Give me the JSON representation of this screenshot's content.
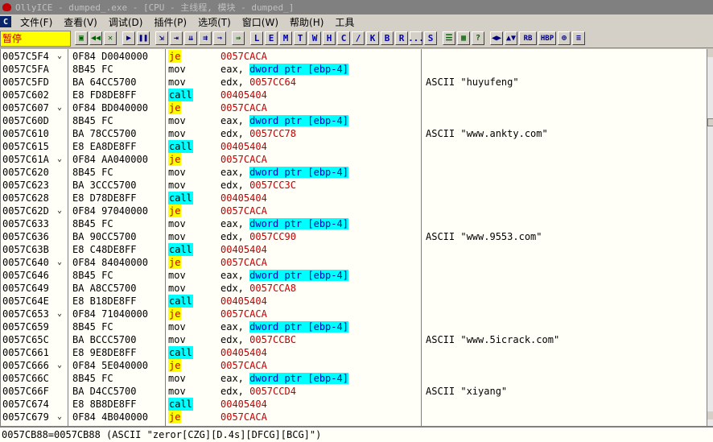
{
  "window": {
    "title": "OllyICE - dumped_.exe - [CPU - 主线程, 模块 - dumped_]"
  },
  "menu": {
    "cpu_icon": "C",
    "items": [
      "文件(F)",
      "查看(V)",
      "调试(D)",
      "插件(P)",
      "选项(T)",
      "窗口(W)",
      "帮助(H)",
      "工具"
    ]
  },
  "toolbar": {
    "status": "暂停",
    "letters": [
      "L",
      "E",
      "M",
      "T",
      "W",
      "H",
      "C",
      "/",
      "K",
      "B",
      "R",
      "...",
      "S"
    ]
  },
  "rows": [
    {
      "addr": "0057C5F4",
      "mark": "⌄",
      "hex": "0F84 D0040000",
      "mnem": "je",
      "type": "je",
      "ops": "0057CACA",
      "comment": ""
    },
    {
      "addr": "0057C5FA",
      "mark": "",
      "hex": "8B45 FC",
      "mnem": "mov",
      "type": "",
      "ops_pre": "eax, ",
      "ops_hl": "dword ptr [ebp-4]",
      "comment": ""
    },
    {
      "addr": "0057C5FD",
      "mark": "",
      "hex": "BA 64CC5700",
      "mnem": "mov",
      "type": "",
      "ops_pre": "edx, ",
      "ops_red": "0057CC64",
      "comment": "ASCII \"huyufeng\""
    },
    {
      "addr": "0057C602",
      "mark": "",
      "hex": "E8 FD8DE8FF",
      "mnem": "call",
      "type": "call",
      "ops": "00405404",
      "comment": ""
    },
    {
      "addr": "0057C607",
      "mark": "⌄",
      "hex": "0F84 BD040000",
      "mnem": "je",
      "type": "je",
      "ops": "0057CACA",
      "comment": ""
    },
    {
      "addr": "0057C60D",
      "mark": "",
      "hex": "8B45 FC",
      "mnem": "mov",
      "type": "",
      "ops_pre": "eax, ",
      "ops_hl": "dword ptr [ebp-4]",
      "comment": ""
    },
    {
      "addr": "0057C610",
      "mark": "",
      "hex": "BA 78CC5700",
      "mnem": "mov",
      "type": "",
      "ops_pre": "edx, ",
      "ops_red": "0057CC78",
      "comment": "ASCII \"www.ankty.com\""
    },
    {
      "addr": "0057C615",
      "mark": "",
      "hex": "E8 EA8DE8FF",
      "mnem": "call",
      "type": "call",
      "ops": "00405404",
      "comment": ""
    },
    {
      "addr": "0057C61A",
      "mark": "⌄",
      "hex": "0F84 AA040000",
      "mnem": "je",
      "type": "je",
      "ops": "0057CACA",
      "comment": ""
    },
    {
      "addr": "0057C620",
      "mark": "",
      "hex": "8B45 FC",
      "mnem": "mov",
      "type": "",
      "ops_pre": "eax, ",
      "ops_hl": "dword ptr [ebp-4]",
      "comment": ""
    },
    {
      "addr": "0057C623",
      "mark": "",
      "hex": "BA 3CCC5700",
      "mnem": "mov",
      "type": "",
      "ops_pre": "edx, ",
      "ops_red": "0057CC3C",
      "comment": ""
    },
    {
      "addr": "0057C628",
      "mark": "",
      "hex": "E8 D78DE8FF",
      "mnem": "call",
      "type": "call",
      "ops": "00405404",
      "comment": ""
    },
    {
      "addr": "0057C62D",
      "mark": "⌄",
      "hex": "0F84 97040000",
      "mnem": "je",
      "type": "je",
      "ops": "0057CACA",
      "comment": ""
    },
    {
      "addr": "0057C633",
      "mark": "",
      "hex": "8B45 FC",
      "mnem": "mov",
      "type": "",
      "ops_pre": "eax, ",
      "ops_hl": "dword ptr [ebp-4]",
      "comment": ""
    },
    {
      "addr": "0057C636",
      "mark": "",
      "hex": "BA 90CC5700",
      "mnem": "mov",
      "type": "",
      "ops_pre": "edx, ",
      "ops_red": "0057CC90",
      "comment": "ASCII \"www.9553.com\""
    },
    {
      "addr": "0057C63B",
      "mark": "",
      "hex": "E8 C48DE8FF",
      "mnem": "call",
      "type": "call",
      "ops": "00405404",
      "comment": ""
    },
    {
      "addr": "0057C640",
      "mark": "⌄",
      "hex": "0F84 84040000",
      "mnem": "je",
      "type": "je",
      "ops": "0057CACA",
      "comment": ""
    },
    {
      "addr": "0057C646",
      "mark": "",
      "hex": "8B45 FC",
      "mnem": "mov",
      "type": "",
      "ops_pre": "eax, ",
      "ops_hl": "dword ptr [ebp-4]",
      "comment": ""
    },
    {
      "addr": "0057C649",
      "mark": "",
      "hex": "BA A8CC5700",
      "mnem": "mov",
      "type": "",
      "ops_pre": "edx, ",
      "ops_red": "0057CCA8",
      "comment": ""
    },
    {
      "addr": "0057C64E",
      "mark": "",
      "hex": "E8 B18DE8FF",
      "mnem": "call",
      "type": "call",
      "ops": "00405404",
      "comment": ""
    },
    {
      "addr": "0057C653",
      "mark": "⌄",
      "hex": "0F84 71040000",
      "mnem": "je",
      "type": "je",
      "ops": "0057CACA",
      "comment": ""
    },
    {
      "addr": "0057C659",
      "mark": "",
      "hex": "8B45 FC",
      "mnem": "mov",
      "type": "",
      "ops_pre": "eax, ",
      "ops_hl": "dword ptr [ebp-4]",
      "comment": ""
    },
    {
      "addr": "0057C65C",
      "mark": "",
      "hex": "BA BCCC5700",
      "mnem": "mov",
      "type": "",
      "ops_pre": "edx, ",
      "ops_red": "0057CCBC",
      "comment": "ASCII \"www.5icrack.com\""
    },
    {
      "addr": "0057C661",
      "mark": "",
      "hex": "E8 9E8DE8FF",
      "mnem": "call",
      "type": "call",
      "ops": "00405404",
      "comment": ""
    },
    {
      "addr": "0057C666",
      "mark": "⌄",
      "hex": "0F84 5E040000",
      "mnem": "je",
      "type": "je",
      "ops": "0057CACA",
      "comment": ""
    },
    {
      "addr": "0057C66C",
      "mark": "",
      "hex": "8B45 FC",
      "mnem": "mov",
      "type": "",
      "ops_pre": "eax, ",
      "ops_hl": "dword ptr [ebp-4]",
      "comment": ""
    },
    {
      "addr": "0057C66F",
      "mark": "",
      "hex": "BA D4CC5700",
      "mnem": "mov",
      "type": "",
      "ops_pre": "edx, ",
      "ops_red": "0057CCD4",
      "comment": "ASCII \"xiyang\""
    },
    {
      "addr": "0057C674",
      "mark": "",
      "hex": "E8 8B8DE8FF",
      "mnem": "call",
      "type": "call",
      "ops": "00405404",
      "comment": ""
    },
    {
      "addr": "0057C679",
      "mark": "⌄",
      "hex": "0F84 4B040000",
      "mnem": "je",
      "type": "je",
      "ops": "0057CACA",
      "comment": ""
    }
  ],
  "info": {
    "text": "0057CB88=0057CB88 (ASCII \"zeror[CZG][D.4s][DFCG][BCG]\")"
  }
}
